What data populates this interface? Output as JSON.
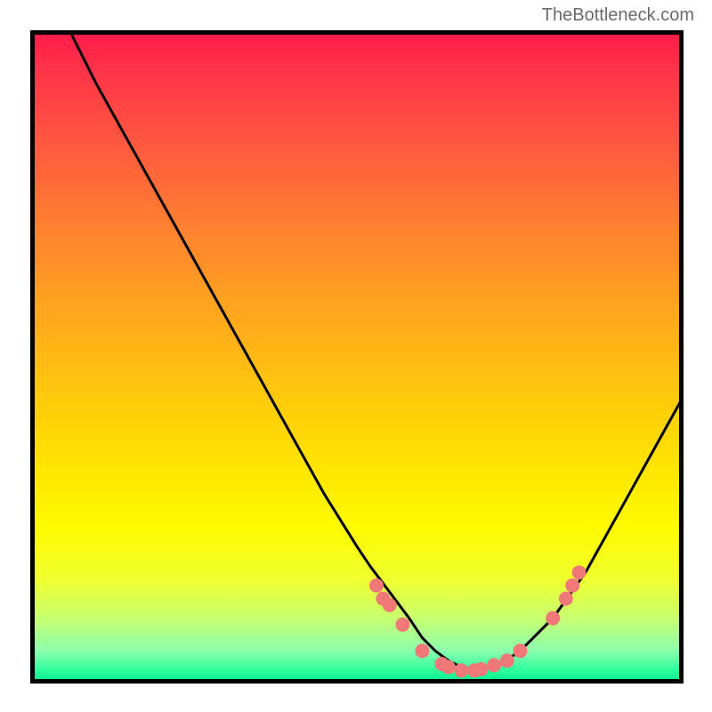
{
  "attribution": "TheBottleneck.com",
  "chart_data": {
    "type": "line",
    "title": "",
    "xlabel": "",
    "ylabel": "",
    "xlim": [
      0,
      100
    ],
    "ylim": [
      0,
      100
    ],
    "series": [
      {
        "name": "curve",
        "x": [
          6,
          10,
          15,
          20,
          25,
          30,
          35,
          40,
          45,
          50,
          52,
          55,
          58,
          60,
          62,
          64,
          66,
          68,
          70,
          72,
          75,
          80,
          85,
          90,
          95,
          100
        ],
        "y": [
          100,
          92,
          83,
          74,
          65,
          56,
          47,
          38,
          29,
          21,
          18,
          14,
          10,
          7,
          5,
          3.5,
          2.5,
          2,
          2.3,
          3,
          5,
          10,
          17,
          26,
          35,
          44
        ]
      }
    ],
    "scatter": {
      "name": "points",
      "color": "#f07878",
      "x": [
        53,
        54,
        55,
        57,
        60,
        63,
        64,
        66,
        68,
        69,
        71,
        73,
        75,
        80,
        82,
        83,
        84
      ],
      "y": [
        15,
        13,
        12,
        9,
        5,
        3,
        2.5,
        2,
        2,
        2.2,
        2.8,
        3.5,
        5,
        10,
        13,
        15,
        17
      ]
    }
  }
}
